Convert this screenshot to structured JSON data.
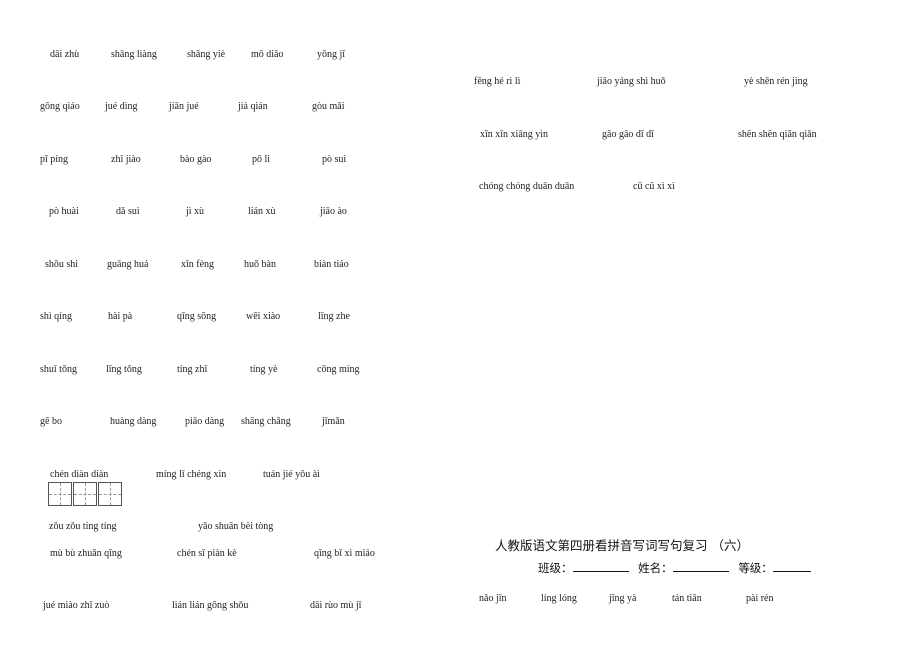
{
  "left_column": {
    "rows": [
      [
        "dāi zhù",
        "shāng liàng",
        "shāng yiè",
        "mō diāo",
        "yōng jǐ"
      ],
      [
        "gōng qiáo",
        "jué dìng",
        "jiān jué",
        "jià qián",
        "gòu mǎi"
      ],
      [
        "pī píng",
        "zhǐ jiào",
        "bào gào",
        "pō li",
        "pò suì"
      ],
      [
        "pò huài",
        "dǎ suì",
        "jì xù",
        "lián xù",
        "jiāo ào"
      ],
      [
        "shōu shi",
        "guāng huá",
        "xīn fèng",
        "huǒ bàn",
        "biàn tiáo"
      ],
      [
        "shì qíng",
        "hài pà",
        "qīng sōng",
        "wēi xiào",
        "līng zhe"
      ],
      [
        "shuǐ tǒng",
        "līng tǒng",
        "tíng zhǐ",
        "tíng yè",
        "cōng míng"
      ],
      [
        "gē bo",
        "huàng dàng",
        "piāo dàng",
        "shāng chǎng",
        "jīmǎn"
      ],
      [
        "chén diàn diàn",
        "míng lǐ chéng xìn",
        "tuán jié yǒu ài"
      ],
      [
        "zǒu zǒu tíng tíng",
        "yǎo shuān bèi tòng"
      ],
      [
        "mù bù zhuǎn qīng",
        "chén sī piàn kè",
        "qīng bǐ xì miáo"
      ],
      [
        "jué miào zhī zuò",
        "lián lián gōng shǒu",
        "dāi rùo mù jī"
      ]
    ]
  },
  "right_column": {
    "rows": [
      [
        "fēng hé rì lì",
        "jiāo yáng shì huǒ",
        "yè shēn rén jìng"
      ],
      [
        "xīn xīn xiāng yìn",
        "gāo gāo dī dī",
        "shēn shēn qiǎn qiǎn"
      ],
      [
        "chóng chóng duān duān",
        "cū cū xì xì"
      ]
    ],
    "bottom_row": [
      "nǎo jīn",
      "líng lóng",
      "jīng yà",
      "tán tiān",
      "pài rén"
    ]
  },
  "header": {
    "title": "人教版语文第四册看拼音写词写句复习 （六）",
    "class_label": "班级：",
    "name_label": "姓名：",
    "grade_label": "等级："
  }
}
